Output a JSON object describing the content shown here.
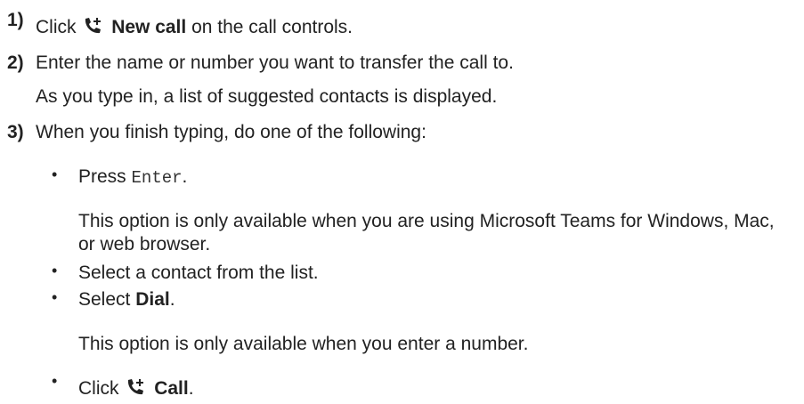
{
  "steps": [
    {
      "number": "1)",
      "prefix": "Click",
      "icon": "phone-plus-icon",
      "bold": "New call",
      "suffix": "on the call controls."
    },
    {
      "number": "2)",
      "text": "Enter the name or number you want to transfer the call to.",
      "note": "As you type in, a list of suggested contacts is displayed."
    },
    {
      "number": "3)",
      "text": "When you finish typing, do one of the following:",
      "bullets": [
        {
          "prefix": "Press",
          "code": "Enter",
          "suffix": ".",
          "note": "This option is only available when you are using Microsoft Teams for Windows, Mac, or web browser."
        },
        {
          "text": "Select a contact from the list."
        },
        {
          "prefix": "Select",
          "bold": "Dial",
          "suffix": ".",
          "note": "This option is only available when you enter a number."
        },
        {
          "prefix": "Click",
          "icon": "phone-plus-icon",
          "bold": "Call",
          "suffix": "."
        }
      ]
    }
  ],
  "bullet_char": "•"
}
